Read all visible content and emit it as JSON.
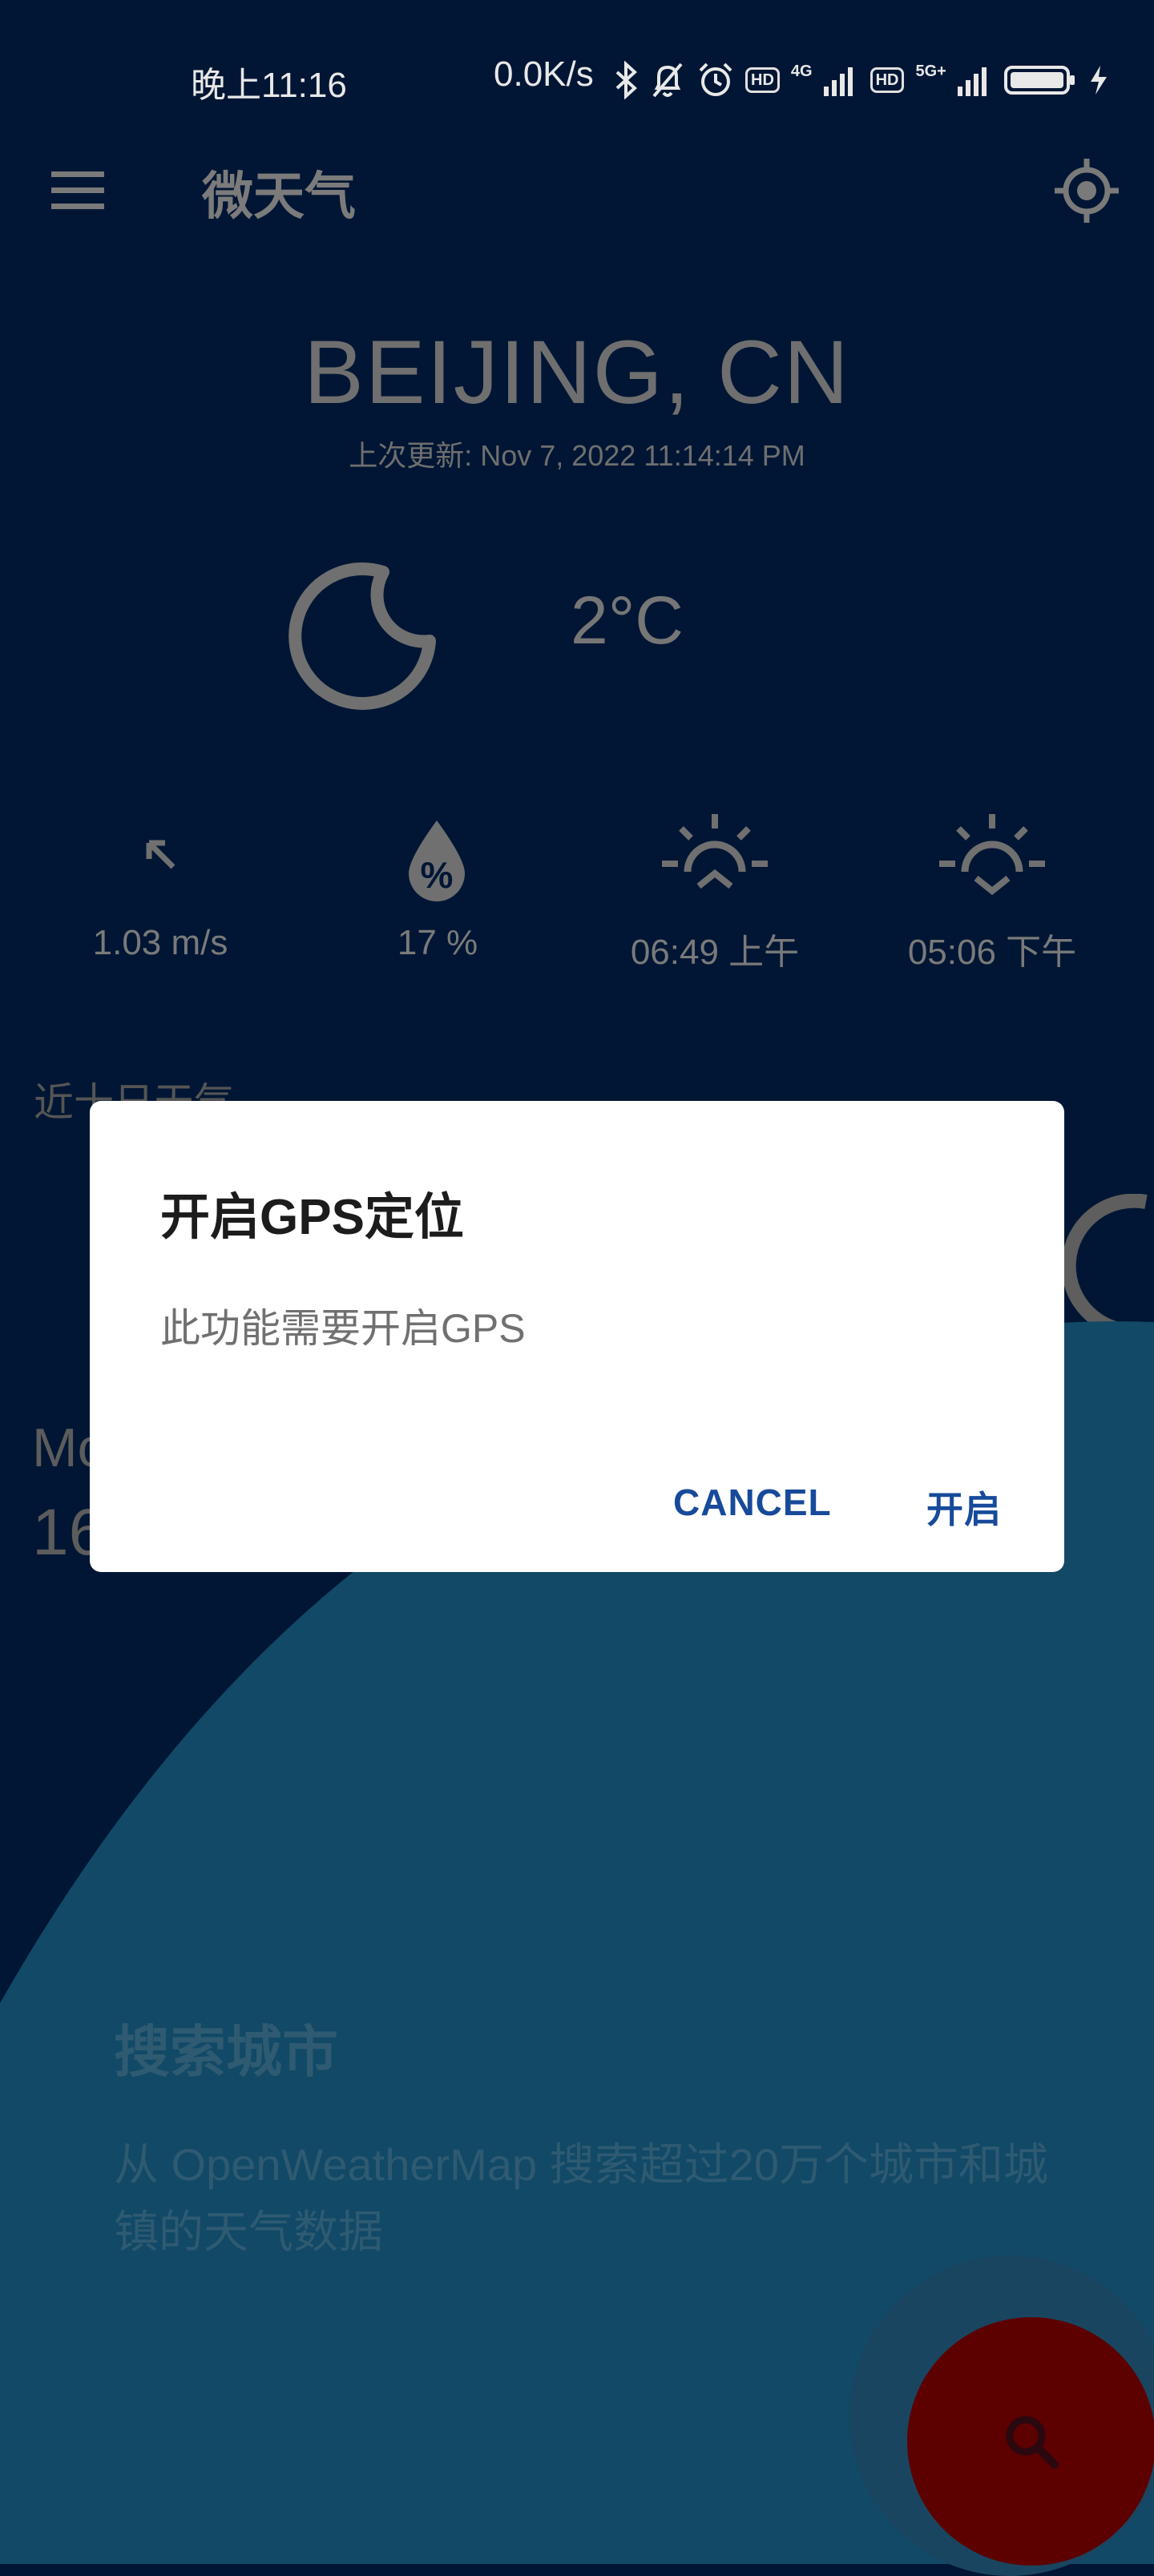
{
  "status_bar": {
    "time": "晚上11:16",
    "net_speed": "0.0K/s",
    "hd1": "HD",
    "net1": "4G",
    "hd2": "HD",
    "net2": "5G+"
  },
  "app_bar": {
    "title": "微天气",
    "menu_icon": "hamburger-menu-icon",
    "locate_icon": "gps-locate-icon"
  },
  "current": {
    "city": "BEIJING, CN",
    "updated": "上次更新: Nov 7, 2022 11:14:14 PM",
    "condition_icon": "crescent-moon-icon",
    "temperature": "2°C"
  },
  "stats": [
    {
      "icon": "wind-direction-arrow-icon",
      "value": "1.03 m/s"
    },
    {
      "icon": "humidity-drop-icon",
      "value": "17 %"
    },
    {
      "icon": "sunrise-icon",
      "value": "06:49 上午"
    },
    {
      "icon": "sunset-icon",
      "value": "05:06 下午"
    }
  ],
  "forecast": {
    "section_title": "近十日天气",
    "day_label_partial": "Mo",
    "temp_partial": "16"
  },
  "search_panel": {
    "title": "搜索城市",
    "description": "从 OpenWeatherMap 搜索超过20万个城市和城镇的天气数据",
    "fab_icon": "search-icon"
  },
  "dialog": {
    "title": "开启GPS定位",
    "message": "此功能需要开启GPS",
    "cancel_label": "CANCEL",
    "ok_label": "开启"
  },
  "colors": {
    "background": "#001634",
    "panel": "#114966",
    "accent_button": "#174a9a",
    "fab": "#5c0000"
  }
}
